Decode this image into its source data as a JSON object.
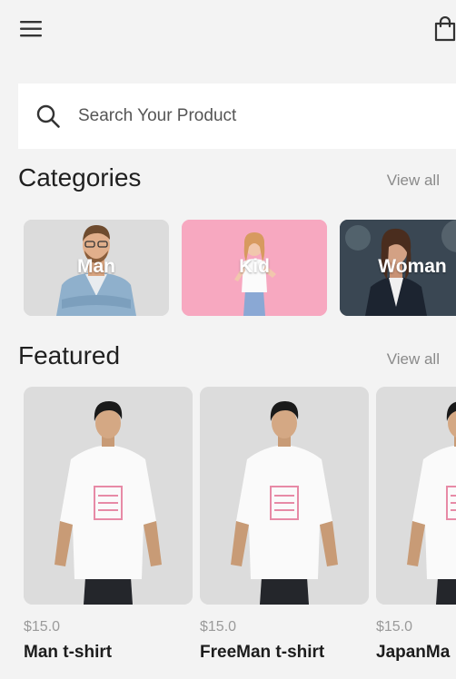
{
  "search": {
    "placeholder": "Search Your Product"
  },
  "categories": {
    "title": "Categories",
    "view_all": "View all",
    "items": [
      {
        "label": "Man",
        "color": "#dcdcdc"
      },
      {
        "label": "Kid",
        "color": "#f7a8c0"
      },
      {
        "label": "Woman",
        "color": "#2e3a44"
      }
    ]
  },
  "featured": {
    "title": "Featured",
    "view_all": "View all",
    "items": [
      {
        "price": "$15.0",
        "name": "Man t-shirt"
      },
      {
        "price": "$15.0",
        "name": "FreeMan t-shirt"
      },
      {
        "price": "$15.0",
        "name": "JapanMa"
      }
    ]
  }
}
